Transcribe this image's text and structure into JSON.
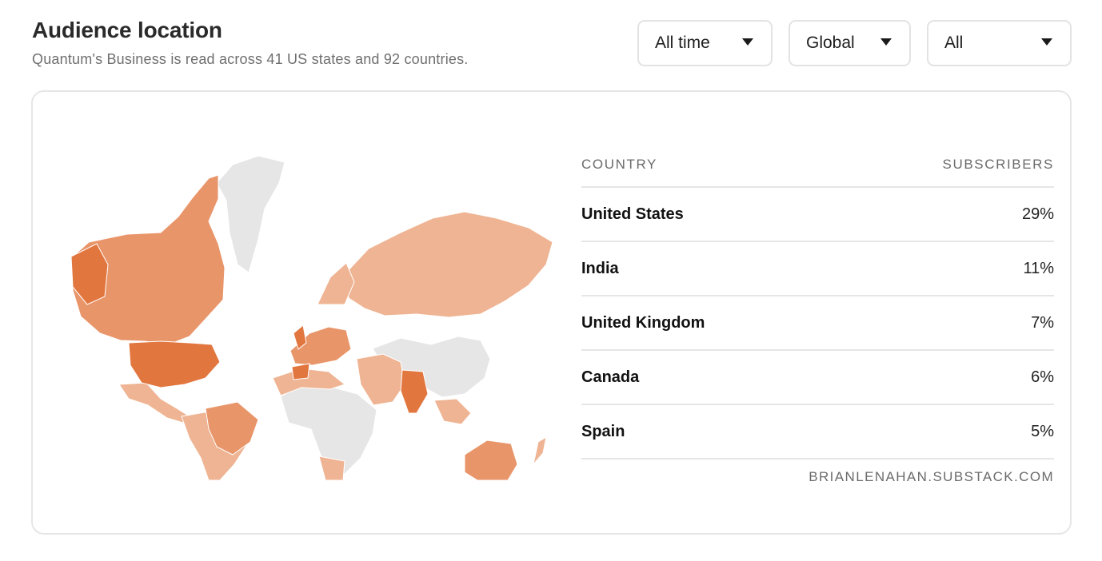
{
  "header": {
    "title": "Audience location",
    "subtitle": "Quantum's Business is read across 41 US states and 92 countries."
  },
  "filters": {
    "time": {
      "value": "All time",
      "icon": "caret-down-icon"
    },
    "region": {
      "value": "Global",
      "icon": "caret-down-icon"
    },
    "type": {
      "value": "All",
      "icon": "caret-down-icon"
    }
  },
  "map": {
    "colors": {
      "high": "#e2763f",
      "mid": "#e9956a",
      "low": "#efb493",
      "none": "#e6e6e6"
    }
  },
  "table": {
    "col_country": "COUNTRY",
    "col_subscribers": "SUBSCRIBERS",
    "rows": [
      {
        "country": "United States",
        "share": "29%"
      },
      {
        "country": "India",
        "share": "11%"
      },
      {
        "country": "United Kingdom",
        "share": "7%"
      },
      {
        "country": "Canada",
        "share": "6%"
      },
      {
        "country": "Spain",
        "share": "5%"
      }
    ],
    "source": "BRIANLENAHAN.SUBSTACK.COM"
  }
}
